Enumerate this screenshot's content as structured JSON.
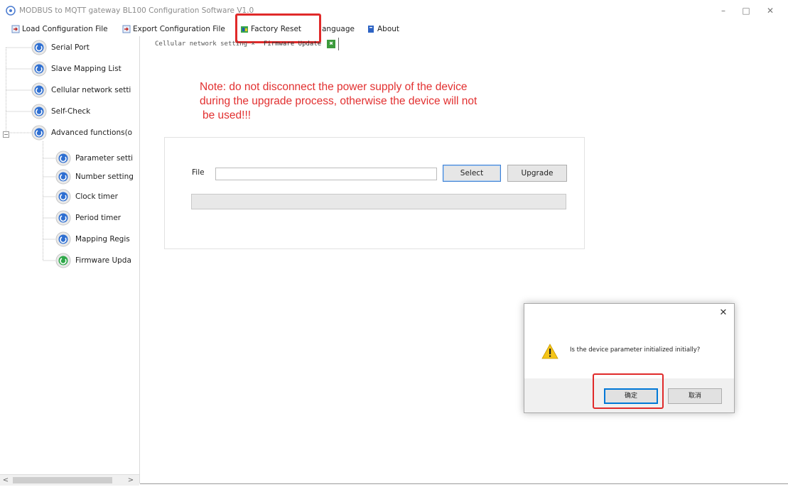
{
  "window": {
    "title": "MODBUS to MQTT gateway BL100 Configuration Software V1.0",
    "minimize_glyph": "–",
    "maximize_glyph": "□",
    "close_glyph": "✕"
  },
  "menu": {
    "load": "Load Configuration File",
    "export": "Export Configuration File",
    "factory_reset": "Factory Reset",
    "language": "anguage",
    "about": "About"
  },
  "sidebar": {
    "items": [
      {
        "label": "Serial Port",
        "icon": "gear-blue-icon"
      },
      {
        "label": "Slave Mapping List",
        "icon": "gear-blue-icon"
      },
      {
        "label": "Cellular network setti",
        "icon": "gear-blue-icon"
      },
      {
        "label": "Self-Check",
        "icon": "gear-blue-icon"
      },
      {
        "label": "Advanced functions(o",
        "icon": "gear-blue-icon"
      },
      {
        "label": "Parameter setti",
        "icon": "gear-blue-icon"
      },
      {
        "label": "Number setting",
        "icon": "gear-blue-icon"
      },
      {
        "label": "Clock timer",
        "icon": "gear-blue-icon"
      },
      {
        "label": "Period timer",
        "icon": "gear-blue-icon"
      },
      {
        "label": "Mapping Regis",
        "icon": "gear-blue-icon"
      },
      {
        "label": "Firmware Upda",
        "icon": "gear-green-icon"
      }
    ],
    "expander_glyph": "−",
    "scroll_left": "<",
    "scroll_right": ">"
  },
  "tabs": {
    "cellular": "Cellular network setting ×",
    "firmware": "Firmware Update",
    "close_glyph": "✖"
  },
  "note": {
    "line1": "Note: do not disconnect the power supply of the device",
    "line2": "during the upgrade process, otherwise the device will not",
    "line3": "be used!!!"
  },
  "upgrade_panel": {
    "file_label": "File",
    "file_value": "",
    "select_label": "Select",
    "upgrade_label": "Upgrade",
    "progress": 0
  },
  "dialog": {
    "close_glyph": "✕",
    "message": "Is the device parameter initialized initially?",
    "ok_label": "确定",
    "cancel_label": "取消"
  },
  "colors": {
    "highlight": "#e02a2a",
    "note_text": "#e23030",
    "gear_blue": "#2f6fd1",
    "gear_green": "#2fa84a"
  }
}
